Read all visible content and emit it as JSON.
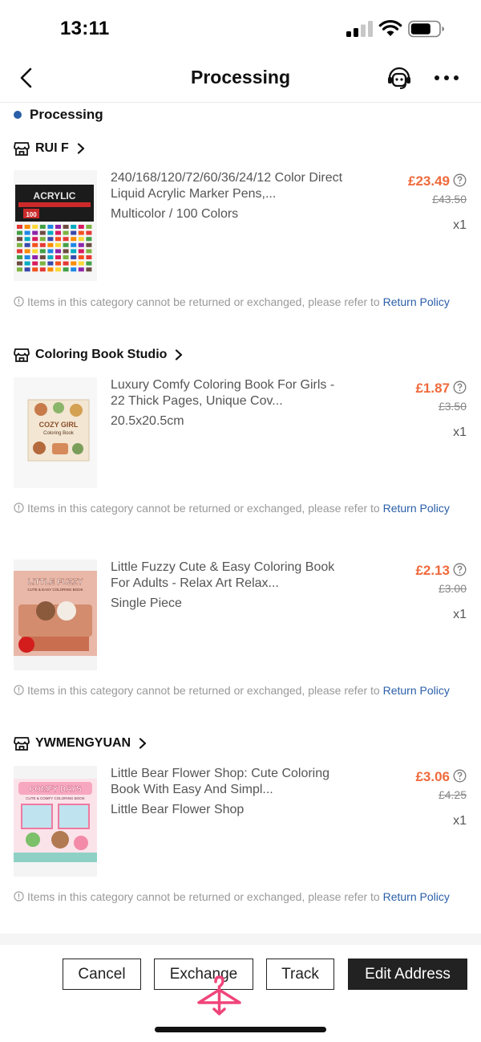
{
  "status_bar": {
    "time": "13:11",
    "icons": [
      "cellular-signal-icon",
      "wifi-icon",
      "battery-icon"
    ]
  },
  "nav": {
    "title": "Processing",
    "icons": [
      "back-arrow-icon",
      "customer-support-icon",
      "more-dots-icon"
    ]
  },
  "order_status": "Processing",
  "colors": {
    "accent_blue": "#2a5ea8",
    "price_orange": "#f06a3c",
    "button_dark": "#222222"
  },
  "notice": {
    "text": "Items in this category cannot be returned or exchanged, please refer to ",
    "link": "Return Policy"
  },
  "stores": [
    {
      "name": "RUI F",
      "items": [
        {
          "title": "240/168/120/72/60/36/24/12 Color Direct Liquid Acrylic Marker Pens,...",
          "variant": "Multicolor / 100 Colors",
          "price": "£23.49",
          "original_price": "£43.50",
          "quantity": "x1",
          "thumb_text": "ACRYLIC",
          "thumb_badge": "100"
        }
      ]
    },
    {
      "name": "Coloring Book Studio",
      "items": [
        {
          "title": "Luxury Comfy Coloring Book For Girls - 22 Thick Pages, Unique Cov...",
          "variant": "20.5x20.5cm",
          "price": "£1.87",
          "original_price": "£3.50",
          "quantity": "x1",
          "thumb_text": "COZY GIRL",
          "thumb_sub": "Coloring Book"
        },
        {
          "title": "Little Fuzzy Cute & Easy Coloring Book For Adults - Relax Art Relax...",
          "variant": "Single Piece",
          "price": "£2.13",
          "original_price": "£3.00",
          "quantity": "x1",
          "thumb_text": "LITTLE FUZZY",
          "thumb_sub": "CUTE & EASY COLORING BOOK"
        }
      ]
    },
    {
      "name": "YWMENGYUAN",
      "items": [
        {
          "title": "Little Bear Flower Shop: Cute Coloring Book With Easy And Simpl...",
          "variant": "Little Bear Flower Shop",
          "price": "£3.06",
          "original_price": "£4.25",
          "quantity": "x1",
          "thumb_text": "COMFY DAYS",
          "thumb_sub": "CUTE & COMFY COLORING BOOK"
        }
      ]
    }
  ],
  "actions": {
    "cancel": "Cancel",
    "exchange": "Exchange",
    "track": "Track",
    "edit_address": "Edit Address"
  }
}
